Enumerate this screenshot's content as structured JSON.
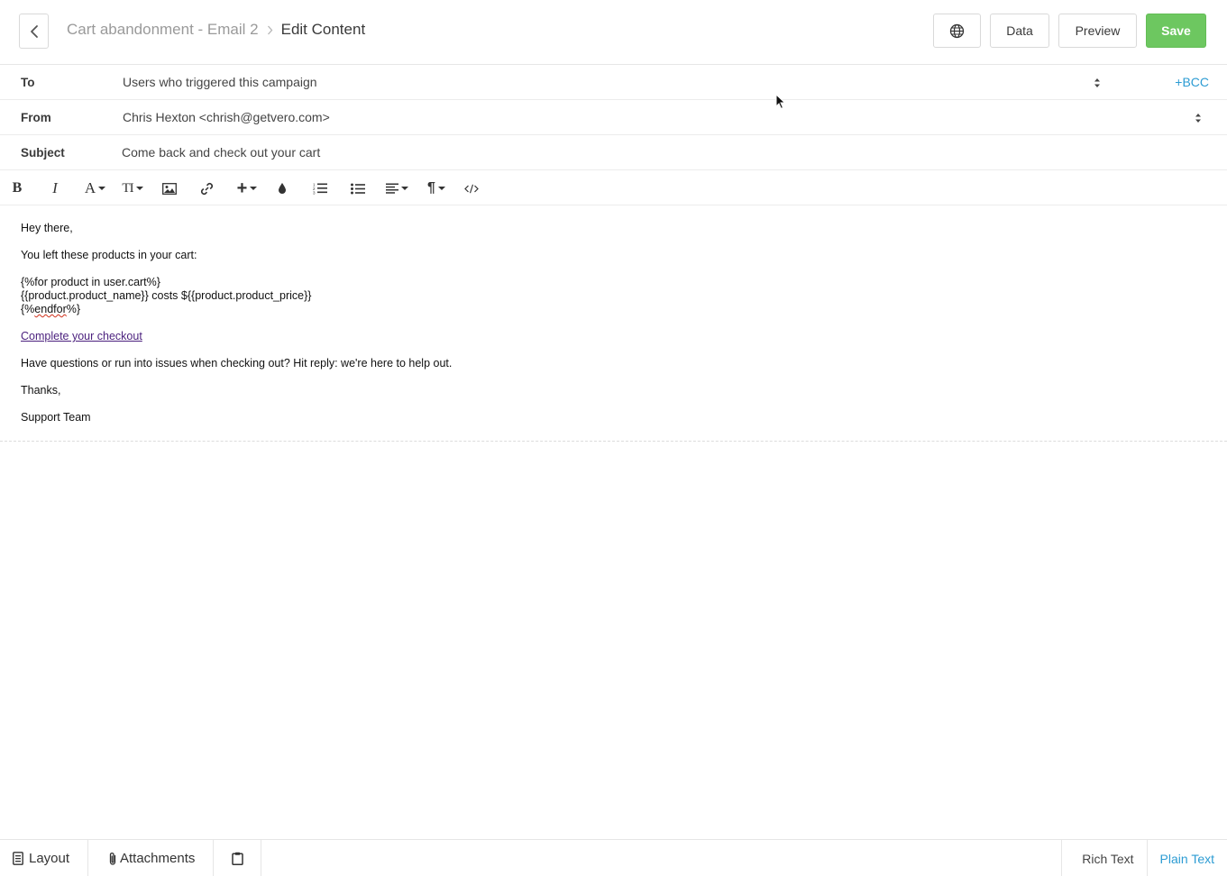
{
  "header": {
    "breadcrumb_parent": "Cart abandonment - Email 2",
    "breadcrumb_current": "Edit Content",
    "data_label": "Data",
    "preview_label": "Preview",
    "save_label": "Save",
    "save_color": "#6dc760"
  },
  "fields": {
    "to_label": "To",
    "to_value": "Users who triggered this campaign",
    "bcc_label": "+BCC",
    "from_label": "From",
    "from_value": "Chris Hexton <chrish@getvero.com>",
    "subject_label": "Subject",
    "subject_value": "Come back and check out your cart"
  },
  "toolbar": {
    "icons": [
      "bold-icon",
      "italic-icon",
      "font-color-icon",
      "font-size-icon",
      "image-icon",
      "link-icon",
      "insert-icon",
      "color-fill-icon",
      "ordered-list-icon",
      "unordered-list-icon",
      "align-icon",
      "paragraph-icon",
      "code-view-icon"
    ],
    "bold": "B",
    "italic": "I",
    "font": "A",
    "font_size": "TI",
    "insert": "+",
    "paragraph": "¶"
  },
  "body": {
    "greeting": "Hey there,",
    "intro": "You left these products in your cart:",
    "loop_start": "{%for product in user.cart%}",
    "loop_body": "{{product.product_name}} costs ${{product.product_price}}",
    "loop_end_prefix": "{%",
    "loop_end_word": "endfor",
    "loop_end_suffix": "%}",
    "checkout_link": "Complete your checkout",
    "help_text": "Have questions or run into issues when checking out? Hit reply: we're here to help out.",
    "signoff": "Thanks,",
    "signature": "Support Team",
    "link_color": "#4a1f7d"
  },
  "footer": {
    "layout_label": "Layout",
    "attachments_label": "Attachments",
    "rich_text_label": "Rich Text",
    "plain_text_label": "Plain Text",
    "active_mode_color": "#2d9cd3"
  }
}
